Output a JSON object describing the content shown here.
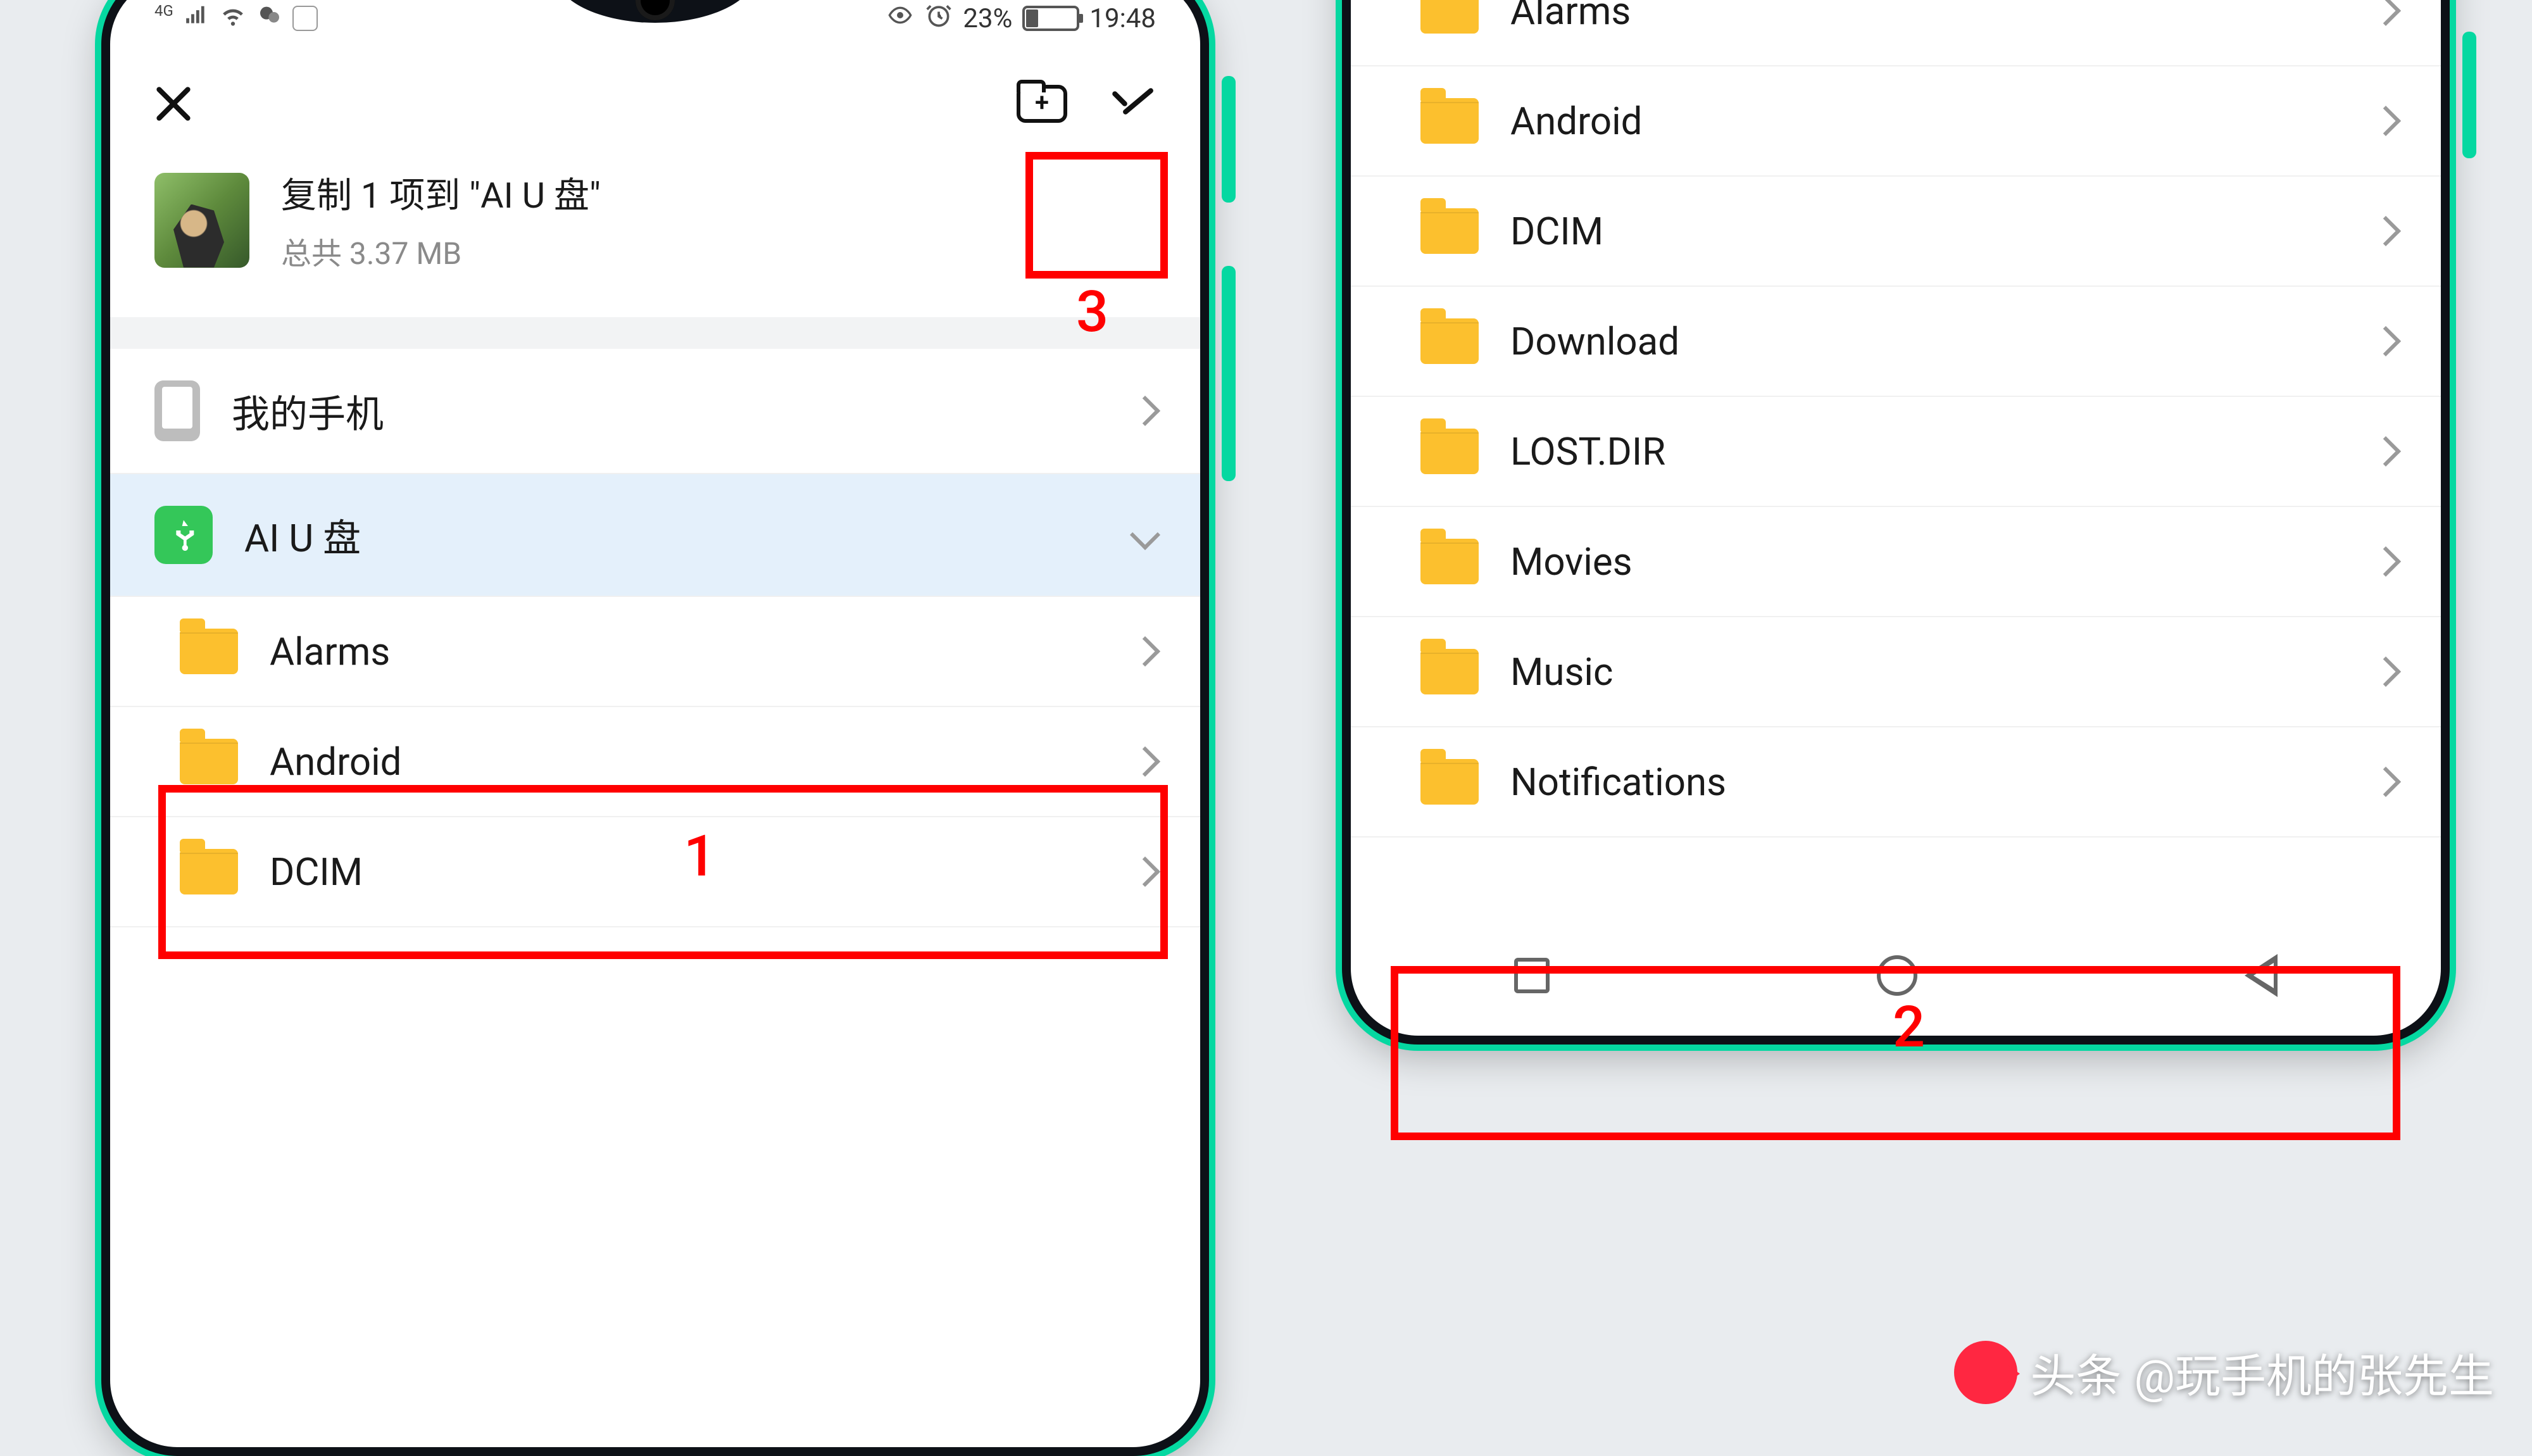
{
  "status": {
    "network": "4G",
    "battery_pct": "23%",
    "time": "19:48"
  },
  "toolbar": {
    "copy_title": "复制 1 项到 \"AI U 盘\"",
    "copy_sub": "总共 3.37 MB"
  },
  "storage": {
    "my_phone": "我的手机",
    "ai_usb": "AI U 盘"
  },
  "folders_left": [
    {
      "name": "Alarms"
    },
    {
      "name": "Android"
    },
    {
      "name": "DCIM"
    }
  ],
  "folders_right": [
    {
      "name": "Alarms"
    },
    {
      "name": "Android"
    },
    {
      "name": "DCIM"
    },
    {
      "name": "Download"
    },
    {
      "name": "LOST.DIR"
    },
    {
      "name": "Movies"
    },
    {
      "name": "Music"
    },
    {
      "name": "Notifications"
    }
  ],
  "annotations": {
    "n1": "1",
    "n2": "2",
    "n3": "3"
  },
  "watermark": {
    "brand": "头条",
    "handle": "@玩手机的张先生"
  }
}
